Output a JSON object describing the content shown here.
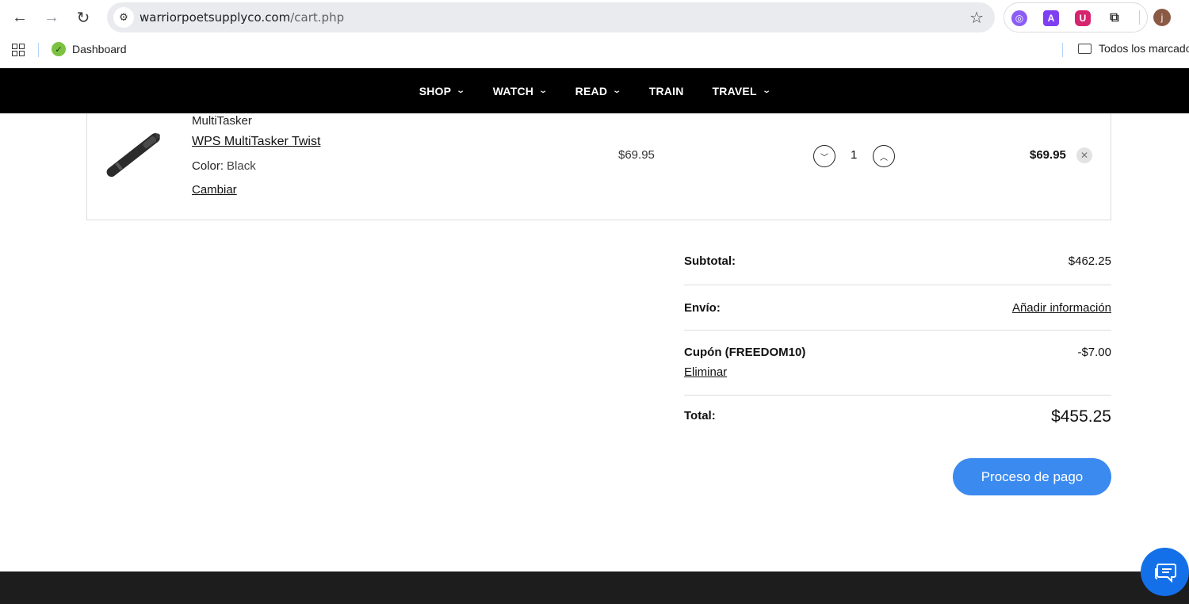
{
  "browser": {
    "url_host": "warriorpoetsupplyco.com",
    "url_path": "/cart.php",
    "profile_initial": "j",
    "bookmarks": [
      {
        "label": "Dashboard"
      },
      {
        "label": "Todos los marcadores"
      }
    ]
  },
  "nav": {
    "items": [
      {
        "label": "SHOP",
        "has_dropdown": true
      },
      {
        "label": "WATCH",
        "has_dropdown": true
      },
      {
        "label": "READ",
        "has_dropdown": true
      },
      {
        "label": "TRAIN",
        "has_dropdown": false
      },
      {
        "label": "TRAVEL",
        "has_dropdown": true
      }
    ]
  },
  "cart_item": {
    "brand": "MultiTasker",
    "name": "WPS MultiTasker Twist",
    "option_label": "Color:",
    "option_value": "Black",
    "change_label": "Cambiar",
    "unit_price": "$69.95",
    "quantity": "1",
    "line_total": "$69.95"
  },
  "summary": {
    "subtotal_label": "Subtotal:",
    "subtotal_value": "$462.25",
    "shipping_label": "Envío:",
    "shipping_value": "Añadir información",
    "coupon_label": "Cupón (FREEDOM10)",
    "coupon_remove": "Eliminar",
    "coupon_value": "-$7.00",
    "total_label": "Total:",
    "total_value": "$455.25"
  },
  "checkout_label": "Proceso de pago",
  "colors": {
    "nav_bg": "#000000",
    "checkout_bg": "#3b8af0",
    "chat_bg": "#1470e8",
    "footer_bg": "#1d1d1d"
  }
}
